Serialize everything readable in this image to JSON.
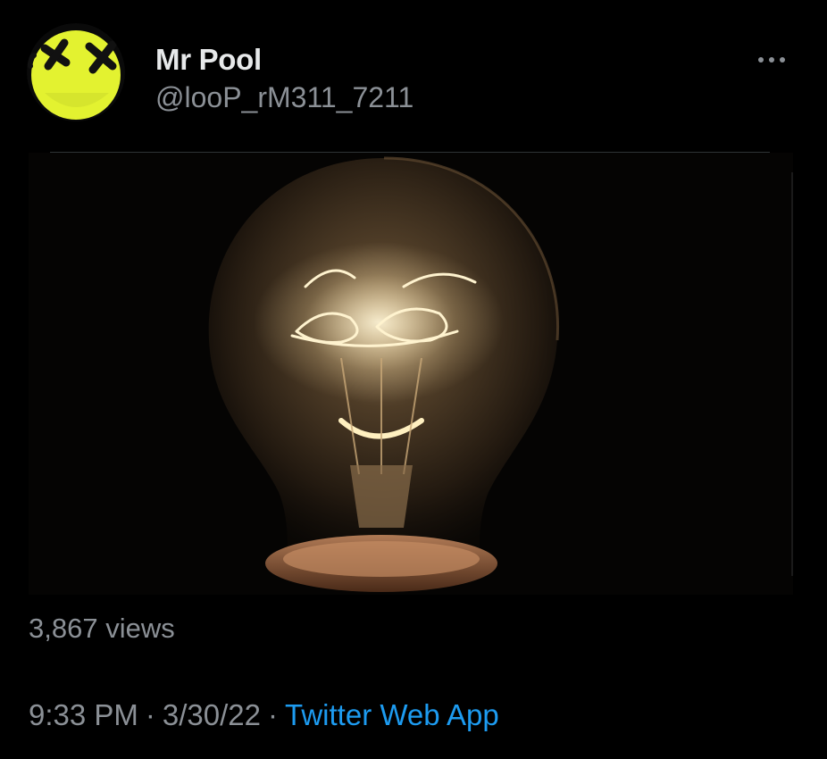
{
  "tweet": {
    "author": {
      "display_name": "Mr Pool",
      "handle": "@looP_rM311_7211",
      "avatar_icon": "yellow-dead-face-icon"
    },
    "more_icon": "more-options-icon",
    "media": {
      "type": "image",
      "subject": "lightbulb-filament-face"
    },
    "views": {
      "count": "3,867",
      "label": "views"
    },
    "meta": {
      "time": "9:33 PM",
      "separator": "·",
      "date": "3/30/22",
      "source": "Twitter Web App"
    }
  },
  "colors": {
    "background": "#000000",
    "text_primary": "#e7e9ea",
    "text_secondary": "#8b9096",
    "link": "#1d9bf0",
    "avatar_yellow": "#e6f53a"
  }
}
